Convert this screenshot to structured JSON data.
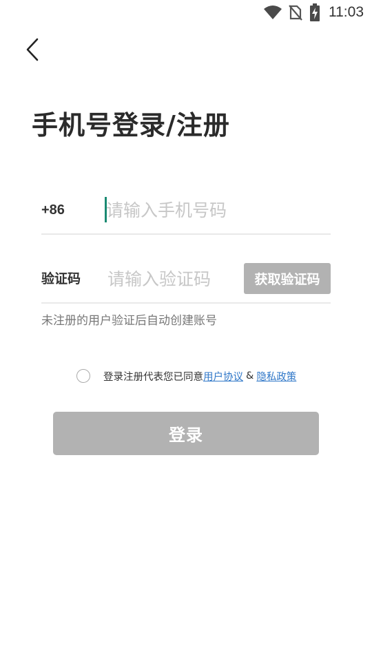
{
  "status_bar": {
    "time": "11:03",
    "icons": [
      "wifi-icon",
      "no-sim-icon",
      "battery-charging-icon"
    ]
  },
  "header": {
    "back_icon": "chevron-left-icon",
    "title": "手机号登录/注册"
  },
  "form": {
    "phone": {
      "country_code": "+86",
      "placeholder": "请输入手机号码",
      "value": ""
    },
    "code": {
      "label": "验证码",
      "placeholder": "请输入验证码",
      "value": "",
      "get_code_label": "获取验证码"
    },
    "hint": "未注册的用户验证后自动创建账号"
  },
  "agreement": {
    "checked": false,
    "prefix": "登录注册代表您已同意",
    "user_agreement": "用户协议",
    "separator": "&",
    "privacy_policy": "隐私政策"
  },
  "login_label": "登录",
  "colors": {
    "disabled_button": "#b2b2b2",
    "link": "#2f77c8",
    "caret": "#1a8a72",
    "divider": "#e9e9e9"
  }
}
